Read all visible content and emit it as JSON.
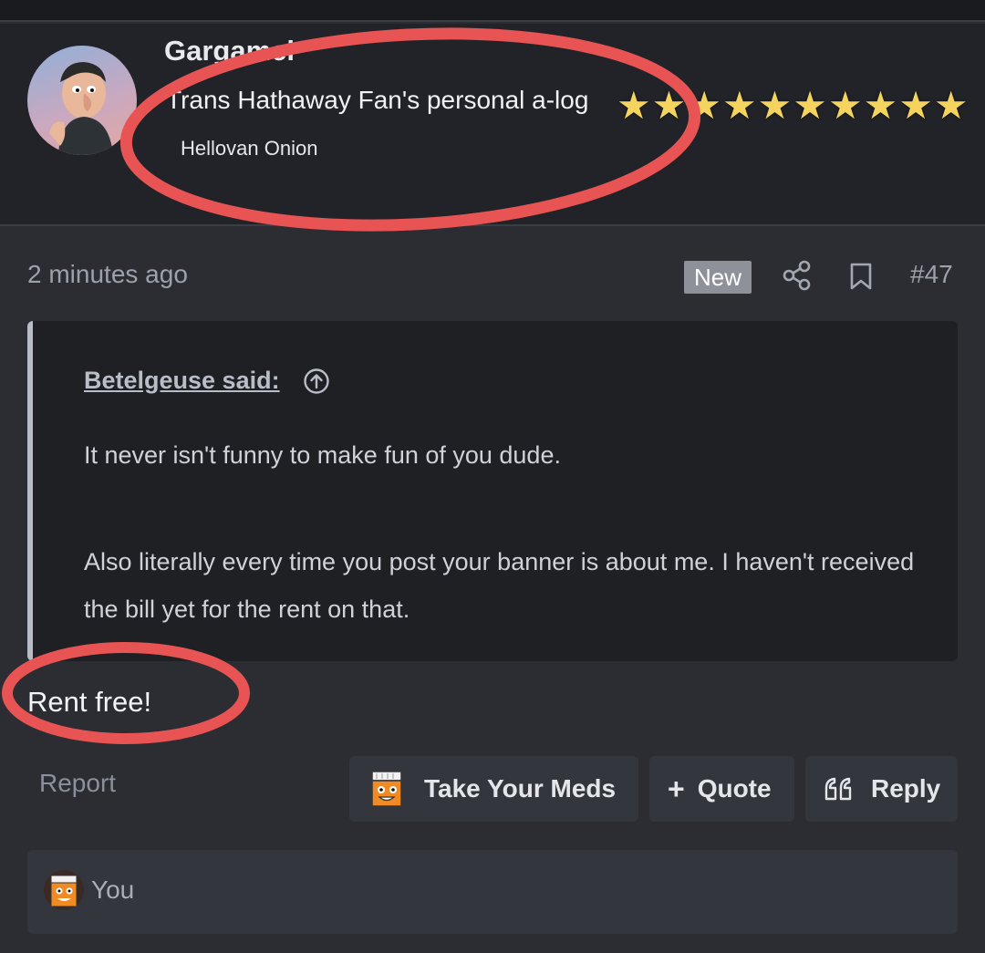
{
  "user": {
    "name": "Gargamel",
    "title": "Trans Hathaway Fan's personal a-log",
    "subtitle": "Hellovan Onion",
    "star_rating": 10
  },
  "post": {
    "time_ago": "2 minutes ago",
    "badge": "New",
    "number": "#47",
    "quote": {
      "author": "Betelgeuse said:",
      "paragraph_1": "It never isn't funny to make fun of you dude.",
      "paragraph_2": "Also literally every time you post your banner is about me. I haven't received the bill yet for the rent on that."
    },
    "body": "Rent free!"
  },
  "actions": {
    "report": "Report",
    "react_label": "Take Your Meds",
    "quote_label": "Quote",
    "reply_label": "Reply"
  },
  "reactions": {
    "you": "You"
  },
  "colors": {
    "background": "#2b2d33",
    "header_bg": "#222328",
    "quote_bg": "#1f2024",
    "button_bg": "#34363d",
    "star": "#f4d35e",
    "annotation": "#e85454"
  },
  "icons": [
    "share-icon",
    "bookmark-icon",
    "arrow-up-circle-icon",
    "plus-icon",
    "quote-marks-icon",
    "take-your-meds-icon"
  ]
}
